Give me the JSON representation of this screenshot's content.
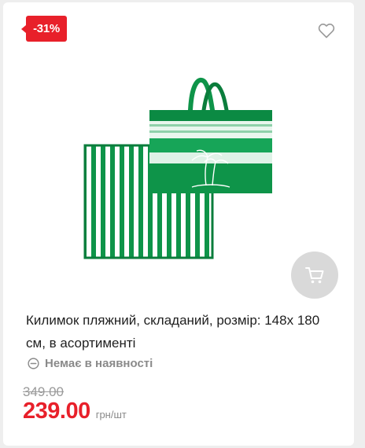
{
  "badge": {
    "discount": "-31%"
  },
  "product": {
    "title": "Килимок пляжний, складаний, розмір: 148х 180 см, в асортименті",
    "stock_status": "Немає в наявності",
    "old_price": "349.00",
    "price": "239.00",
    "unit": "грн/шт"
  },
  "icons": {
    "favorite": "heart-outline-icon",
    "cart": "shopping-cart-icon",
    "stock": "minus-circle-icon"
  },
  "colors": {
    "accent_red": "#e8202a",
    "product_green": "#0e9449",
    "muted_gray": "#8a8a8a"
  }
}
